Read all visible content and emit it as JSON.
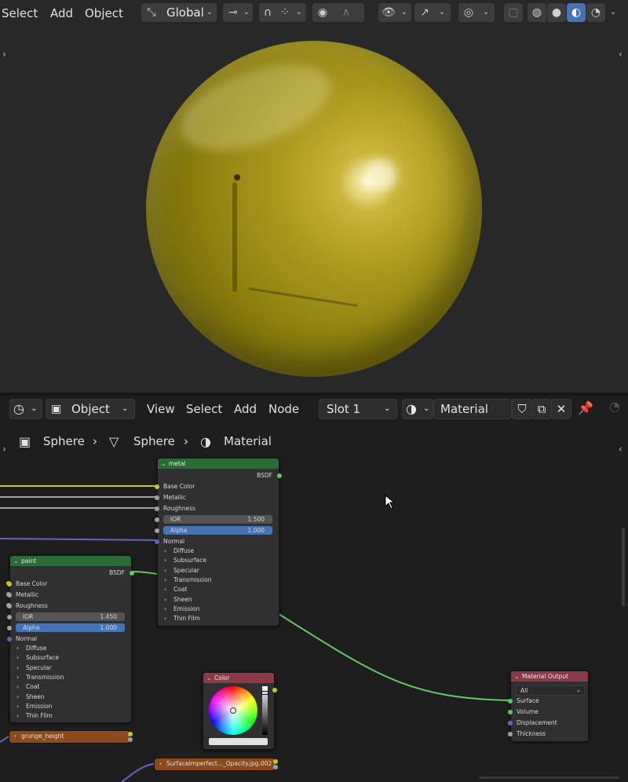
{
  "viewport_header": {
    "menus": [
      "Select",
      "Add",
      "Object"
    ],
    "orientation": "Global"
  },
  "node_header": {
    "mode": "Object",
    "menus": [
      "View",
      "Select",
      "Add",
      "Node"
    ],
    "slot": "Slot 1",
    "material": "Material"
  },
  "breadcrumb": [
    "Sphere",
    "Sphere",
    "Material"
  ],
  "nodes": {
    "metal": {
      "title": "metal",
      "output": "BSDF",
      "inputs": [
        "Base Color",
        "Metallic",
        "Roughness"
      ],
      "ior_label": "IOR",
      "ior_value": "1.500",
      "alpha_label": "Alpha",
      "alpha_value": "1.000",
      "normal": "Normal",
      "panels": [
        "Diffuse",
        "Subsurface",
        "Specular",
        "Transmission",
        "Coat",
        "Sheen",
        "Emission",
        "Thin Film"
      ]
    },
    "paint": {
      "title": "paint",
      "output": "BSDF",
      "inputs": [
        "Base Color",
        "Metallic",
        "Roughness"
      ],
      "ior_label": "IOR",
      "ior_value": "1.450",
      "alpha_label": "Alpha",
      "alpha_value": "1.000",
      "normal": "Normal",
      "panels": [
        "Diffuse",
        "Subsurface",
        "Specular",
        "Transmission",
        "Coat",
        "Sheen",
        "Emission",
        "Thin Film"
      ]
    },
    "color": {
      "title": "Color"
    },
    "output": {
      "title": "Material Output",
      "target": "All",
      "inputs": [
        "Surface",
        "Volume",
        "Displacement",
        "Thickness"
      ]
    },
    "grunge": {
      "title": "grunge_height"
    },
    "surface": {
      "title": "SurfaceImperfect..._Opacity.jpg.002"
    }
  },
  "colors": {
    "accent": "#4772b3",
    "shader_header": "#2b6b37",
    "color_header": "#8a3a48",
    "frame": "#8a4a1c",
    "socket_yellow": "#c7c729",
    "socket_gray": "#a1a1a1",
    "socket_purple": "#6363c7",
    "socket_green": "#63c763"
  }
}
